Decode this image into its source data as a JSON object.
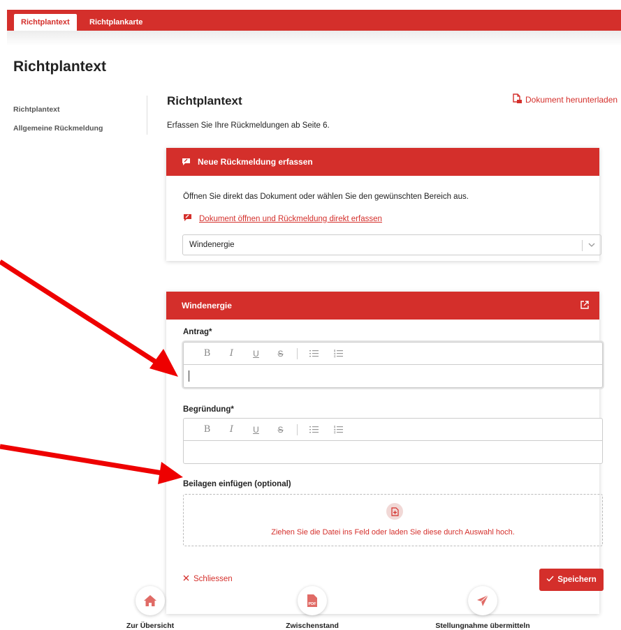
{
  "tabs": [
    {
      "label": "Richtplantext",
      "active": true
    },
    {
      "label": "Richtplankarte",
      "active": false
    }
  ],
  "page_title": "Richtplantext",
  "sidebar": {
    "items": [
      {
        "label": "Richtplantext"
      },
      {
        "label": "Allgemeine Rückmeldung"
      }
    ]
  },
  "main": {
    "title": "Richtplantext",
    "download_label": "Dokument herunterladen",
    "intro": "Erfassen Sie Ihre Rückmeldungen ab Seite 6."
  },
  "new_feedback": {
    "header": "Neue Rückmeldung erfassen",
    "text": "Öffnen Sie direkt das Dokument oder wählen Sie den gewünschten Bereich aus.",
    "direct_link": "Dokument öffnen und Rückmeldung direkt erfassen",
    "select_value": "Windenergie"
  },
  "form": {
    "header": "Windenergie",
    "antrag_label": "Antrag*",
    "antrag_value": "",
    "begruendung_label": "Begründung*",
    "begruendung_value": "",
    "toolbar": {
      "bold": "B",
      "italic": "I",
      "underline": "U",
      "strike": "S"
    },
    "attachments_label": "Beilagen einfügen (optional)",
    "dropzone_text": "Ziehen Sie die Datei ins Feld oder laden Sie diese durch Auswahl hoch.",
    "close_label": "Schliessen",
    "save_label": "Speichern"
  },
  "bottom_nav": [
    {
      "label": "Zur Übersicht",
      "icon": "home-icon"
    },
    {
      "label": "Zwischenstand",
      "icon": "pdf-icon",
      "icon_text": "PDF"
    },
    {
      "label": "Stellungnahme übermitteln",
      "icon": "send-icon"
    }
  ],
  "colors": {
    "accent": "#d42f2b",
    "arrow": "#ee0000"
  }
}
